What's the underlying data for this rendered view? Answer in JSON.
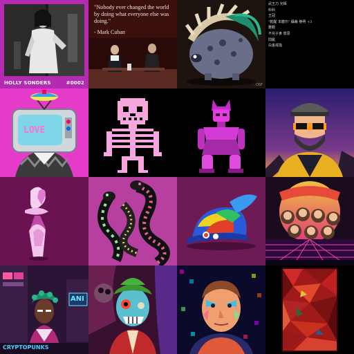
{
  "gallery": {
    "tiles": [
      {
        "name": "holly-sonders",
        "caption_left": "HOLLY SONDERS",
        "caption_right": "#0002",
        "bg": "#b42ab0"
      },
      {
        "name": "mark-cuban-quote",
        "quote": "\"Nobody ever changed the world by doing what everyone else was doing.\"",
        "author": "- Mark Cuban",
        "bg": "#3b0f0c"
      },
      {
        "name": "spiky-creature",
        "corner": "OSF",
        "bg": "#1d1410"
      },
      {
        "name": "chinese-text-list",
        "lines": [
          "武王力 光辉",
          "科科",
          "王冠",
          "\"乾醒 本體尔\" 攝裁 眷明 +3",
          "雅觀",
          "不充子食 憬思",
          "問艇",
          "白金戒指"
        ],
        "bg": "#000000"
      },
      {
        "name": "tv-head-character",
        "tv_text": "LOVE",
        "bg": "#e63ac9"
      },
      {
        "name": "pixel-skeleton",
        "bg": "#000000"
      },
      {
        "name": "pink-robot-figure",
        "bg": "#000000"
      },
      {
        "name": "bearded-man-sunglasses",
        "bg": "#2b1d6e"
      },
      {
        "name": "pink-abstract-sculpture",
        "bg": "#6a1350"
      },
      {
        "name": "colorful-serpents",
        "bg": "#b63fa0"
      },
      {
        "name": "rainbow-cap",
        "bg": "#6e1a55"
      },
      {
        "name": "retro-sunset-poster",
        "bg": "#1a0b1d"
      },
      {
        "name": "cyberpunk-character",
        "sign_text": "ANI",
        "bottom_text": "CRYPTOPUNKS",
        "bg": "#2b1536"
      },
      {
        "name": "zombie-art",
        "bg": "#3a1030"
      },
      {
        "name": "colorful-portrait",
        "bg": "#0a0a2a"
      },
      {
        "name": "red-mosaic",
        "bg": "#000000"
      }
    ]
  }
}
